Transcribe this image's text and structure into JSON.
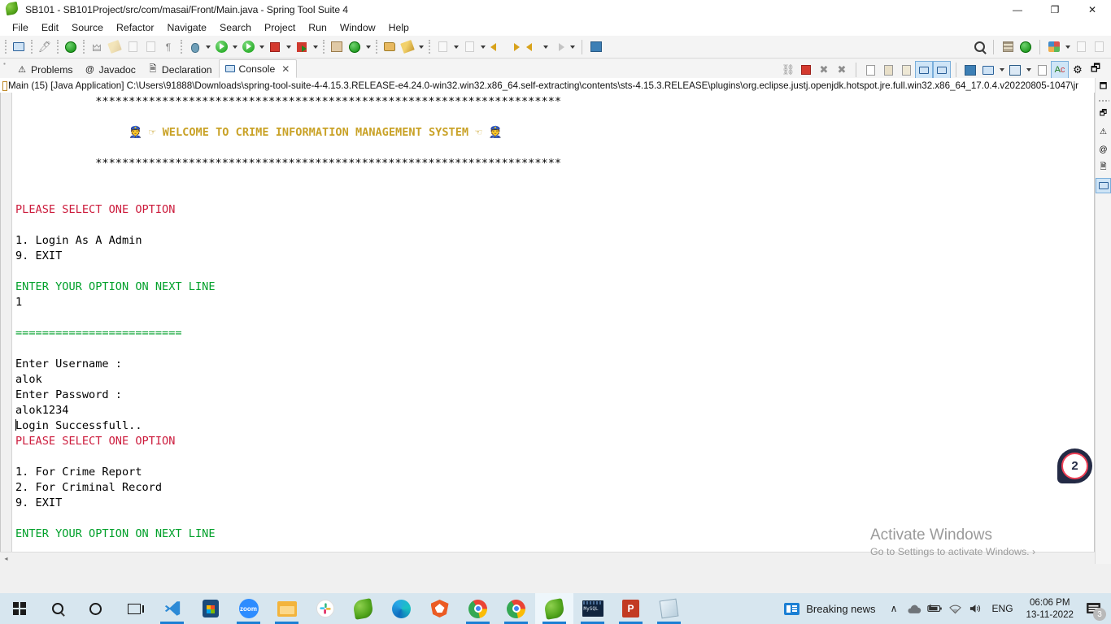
{
  "window": {
    "title": "SB101 - SB101Project/src/com/masai/Front/Main.java - Spring Tool Suite 4",
    "app_icon": "sts-leaf-icon",
    "minimize": "—",
    "maximize": "❐",
    "close": "✕"
  },
  "menubar": {
    "items": [
      {
        "label": "File"
      },
      {
        "label": "Edit"
      },
      {
        "label": "Source"
      },
      {
        "label": "Refactor"
      },
      {
        "label": "Navigate"
      },
      {
        "label": "Search"
      },
      {
        "label": "Project"
      },
      {
        "label": "Run"
      },
      {
        "label": "Window"
      },
      {
        "label": "Help"
      }
    ]
  },
  "toolbar": {
    "icons": [
      {
        "name": "new-java-console-icon"
      },
      {
        "name": "link-broken-icon"
      },
      {
        "name": "spring-boot-dashboard-icon"
      },
      {
        "name": "bean-icon"
      },
      {
        "name": "pencil-icon"
      },
      {
        "name": "export-icon"
      },
      {
        "name": "open-type-icon"
      },
      {
        "name": "pilcrow-icon"
      },
      {
        "name": "debug-icon"
      },
      {
        "name": "run-icon"
      },
      {
        "name": "run-as-server-icon"
      },
      {
        "name": "terminate-icon"
      },
      {
        "name": "relaunch-icon"
      },
      {
        "name": "new-package-icon"
      },
      {
        "name": "git-icon"
      },
      {
        "name": "open-perspective-icon"
      },
      {
        "name": "search-pen-icon"
      },
      {
        "name": "download-icon"
      },
      {
        "name": "upload-icon"
      },
      {
        "name": "previous-annotation-icon"
      },
      {
        "name": "next-annotation-icon"
      },
      {
        "name": "back-icon"
      },
      {
        "name": "forward-icon"
      },
      {
        "name": "new-window-icon"
      }
    ]
  },
  "view_tabs": {
    "tabs": [
      {
        "label": "Problems",
        "icon": "problems-icon",
        "active": false
      },
      {
        "label": "Javadoc",
        "icon": "javadoc-at-icon",
        "active": false
      },
      {
        "label": "Declaration",
        "icon": "declaration-icon",
        "active": false
      },
      {
        "label": "Console",
        "icon": "console-monitor-icon",
        "active": true,
        "close": "✕"
      }
    ],
    "console_toolbar": [
      {
        "name": "show-console-when-output-icon"
      },
      {
        "name": "terminate-icon"
      },
      {
        "name": "remove-launch-icon"
      },
      {
        "name": "remove-all-terminated-icon"
      },
      {
        "name": "clear-console-icon"
      },
      {
        "name": "scroll-lock-icon"
      },
      {
        "name": "word-wrap-icon"
      },
      {
        "name": "pin-console-icon"
      },
      {
        "name": "display-selected-console-icon"
      },
      {
        "name": "open-console-icon"
      },
      {
        "name": "new-console-view-icon"
      },
      {
        "name": "console-preferences-icon"
      },
      {
        "name": "ansi-console-icon"
      },
      {
        "name": "settings-gear-icon"
      },
      {
        "name": "restore-view-icon"
      }
    ]
  },
  "console_label": {
    "text": "Main (15) [Java Application] C:\\Users\\91888\\Downloads\\spring-tool-suite-4-4.15.3.RELEASE-e4.24.0-win32.win32.x86_64.self-extracting\\contents\\sts-4.15.3.RELEASE\\plugins\\org.eclipse.justj.openjdk.hotspot.jre.full.win32.x86_64_17.0.4.v20220805-1047\\jr"
  },
  "console_output": {
    "colors": {
      "red": "#cc1b3c",
      "green": "#00a02a",
      "gold": "#c9a227",
      "black": "#000000"
    },
    "lines": [
      {
        "text": "            **********************************************************************",
        "color": "black"
      },
      {
        "text": "",
        "color": "black"
      },
      {
        "text": "                 👮 ☞ WELCOME TO CRIME INFORMATION MANAGEMENT SYSTEM ☜ 👮",
        "color": "gold"
      },
      {
        "text": "",
        "color": "black"
      },
      {
        "text": "            **********************************************************************",
        "color": "black"
      },
      {
        "text": "",
        "color": "black"
      },
      {
        "text": "",
        "color": "black"
      },
      {
        "text": "PLEASE SELECT ONE OPTION",
        "color": "red"
      },
      {
        "text": "",
        "color": "black"
      },
      {
        "text": "1. Login As A Admin",
        "color": "black"
      },
      {
        "text": "9. EXIT",
        "color": "black"
      },
      {
        "text": "",
        "color": "black"
      },
      {
        "text": "ENTER YOUR OPTION ON NEXT LINE",
        "color": "green"
      },
      {
        "text": "1",
        "color": "black"
      },
      {
        "text": "",
        "color": "black"
      },
      {
        "text": "=========================",
        "color": "green"
      },
      {
        "text": "",
        "color": "black"
      },
      {
        "text": "Enter Username :",
        "color": "black"
      },
      {
        "text": "alok",
        "color": "black"
      },
      {
        "text": "Enter Password :",
        "color": "black"
      },
      {
        "text": "alok1234",
        "color": "black"
      },
      {
        "text": "Login Successfull..",
        "color": "black",
        "caret": true
      },
      {
        "text": "PLEASE SELECT ONE OPTION",
        "color": "red"
      },
      {
        "text": "",
        "color": "black"
      },
      {
        "text": "1. For Crime Report",
        "color": "black"
      },
      {
        "text": "2. For Criminal Record",
        "color": "black"
      },
      {
        "text": "9. EXIT",
        "color": "black"
      },
      {
        "text": "",
        "color": "black"
      },
      {
        "text": "ENTER YOUR OPTION ON NEXT LINE",
        "color": "green"
      }
    ]
  },
  "right_sidebar": {
    "icons": [
      {
        "name": "restore-layout-icon"
      },
      {
        "name": "minimize-view-icon"
      },
      {
        "name": "problems-view-icon"
      },
      {
        "name": "javadoc-view-icon"
      },
      {
        "name": "declaration-view-icon"
      },
      {
        "name": "console-view-icon",
        "selected": true
      }
    ]
  },
  "watermark": {
    "title": "Activate Windows",
    "subtitle": "Go to Settings to activate Windows.",
    "arrow": "›"
  },
  "cursor_badge": {
    "number": "2"
  },
  "scrollbars": {
    "v_up": "▲",
    "v_down": "▼",
    "h_left": "◂"
  },
  "taskbar": {
    "apps": [
      {
        "name": "start-button",
        "label": "Start"
      },
      {
        "name": "search-icon",
        "label": "Search"
      },
      {
        "name": "cortana-icon",
        "label": "Cortana"
      },
      {
        "name": "task-view-icon",
        "label": "Task View"
      },
      {
        "name": "vscode-icon",
        "label": "Visual Studio Code",
        "running": true
      },
      {
        "name": "microsoft-store-icon",
        "label": "Microsoft Store",
        "running": false
      },
      {
        "name": "zoom-icon",
        "label": "Zoom",
        "running": true
      },
      {
        "name": "file-explorer-icon",
        "label": "File Explorer",
        "running": true
      },
      {
        "name": "slack-icon",
        "label": "Slack",
        "running": false
      },
      {
        "name": "spring-tool-suite-icon",
        "label": "Spring Tool Suite",
        "running": false
      },
      {
        "name": "microsoft-edge-icon",
        "label": "Microsoft Edge",
        "running": false
      },
      {
        "name": "brave-icon",
        "label": "Brave",
        "running": false
      },
      {
        "name": "chrome-icon",
        "label": "Google Chrome",
        "running": true
      },
      {
        "name": "chrome-2-icon",
        "label": "Google Chrome",
        "running": true
      },
      {
        "name": "spring-tool-suite-active-icon",
        "label": "Spring Tool Suite 4",
        "running": true,
        "active": true
      },
      {
        "name": "mysql-icon",
        "label": "MySQL Command Line",
        "running": true
      },
      {
        "name": "powerpoint-icon",
        "label": "Microsoft PowerPoint",
        "running": true
      },
      {
        "name": "notepad-icon",
        "label": "Notepad",
        "running": true
      }
    ],
    "tray": {
      "news_label": "Breaking news",
      "news_icon": "news-icon",
      "chevron": "∧",
      "onedrive_icon": "cloud-icon",
      "battery_icon": "battery-icon",
      "wifi_icon": "wifi-icon",
      "volume_icon": "volume-icon",
      "language": "ENG",
      "time": "06:06 PM",
      "date": "13-11-2022",
      "notification_count": "3"
    }
  }
}
